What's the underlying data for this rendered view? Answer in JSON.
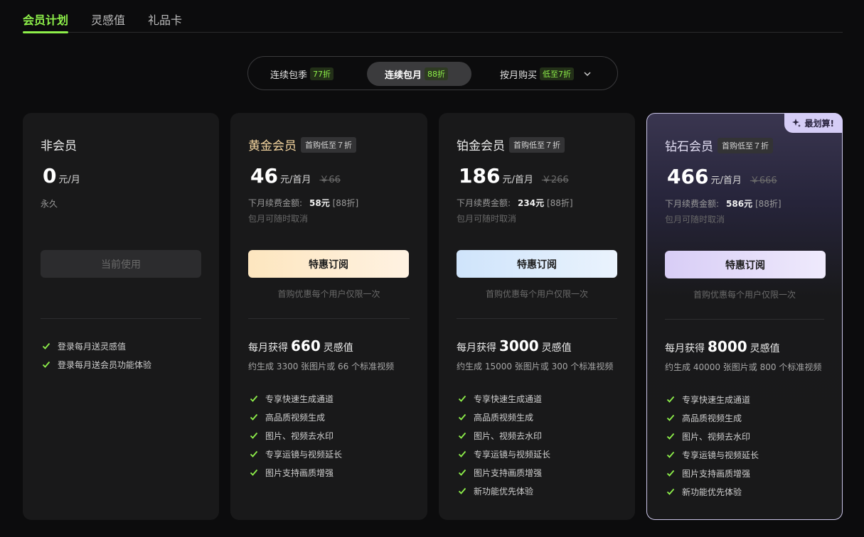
{
  "tabs": [
    {
      "label": "会员计划"
    },
    {
      "label": "灵感值"
    },
    {
      "label": "礼品卡"
    }
  ],
  "billing": {
    "options": [
      {
        "label": "连续包季",
        "badge": "77折"
      },
      {
        "label": "连续包月",
        "badge": "88折"
      },
      {
        "label": "按月购买",
        "badge": "低至7折"
      }
    ],
    "selected": "连续包月"
  },
  "colors": {
    "accent": "#8ef04a",
    "gold": "#fde6bf",
    "platinum": "#cfe4fb",
    "diamond": "#d8cdf6"
  },
  "plans": [
    {
      "name": "非会员",
      "price": "0",
      "unit": "元/月",
      "period_note": "永久",
      "button": "当前使用",
      "features": [
        "登录每月送灵感值",
        "登录每月送会员功能体验"
      ]
    },
    {
      "name": "黄金会员",
      "tag": "首购低至７折",
      "price": "46",
      "unit": "元/首月",
      "orig_price": "￥66",
      "renew_label": "下月续费金额:",
      "renew_amount": "58元",
      "renew_discount": "[88折]",
      "cancel_note": "包月可随时取消",
      "button": "特惠订阅",
      "button_note": "首购优惠每个用户仅限一次",
      "credits_prefix": "每月获得",
      "credits": "660",
      "credits_suffix": "灵感值",
      "gen_note": "约生成 3300 张图片或 66 个标准视频",
      "features": [
        "专享快速生成通道",
        "高品质视频生成",
        "图片、视频去水印",
        "专享运镜与视频延长",
        "图片支持画质增强"
      ]
    },
    {
      "name": "铂金会员",
      "tag": "首购低至７折",
      "price": "186",
      "unit": "元/首月",
      "orig_price": "￥266",
      "renew_label": "下月续费金额:",
      "renew_amount": "234元",
      "renew_discount": "[88折]",
      "cancel_note": "包月可随时取消",
      "button": "特惠订阅",
      "button_note": "首购优惠每个用户仅限一次",
      "credits_prefix": "每月获得",
      "credits": "3000",
      "credits_suffix": "灵感值",
      "gen_note": "约生成 15000 张图片或 300 个标准视频",
      "features": [
        "专享快速生成通道",
        "高品质视频生成",
        "图片、视频去水印",
        "专享运镜与视频延长",
        "图片支持画质增强",
        "新功能优先体验"
      ]
    },
    {
      "name": "钻石会员",
      "tag": "首购低至７折",
      "badge": "最划算!",
      "price": "466",
      "unit": "元/首月",
      "orig_price": "￥666",
      "renew_label": "下月续费金额:",
      "renew_amount": "586元",
      "renew_discount": "[88折]",
      "cancel_note": "包月可随时取消",
      "button": "特惠订阅",
      "button_note": "首购优惠每个用户仅限一次",
      "credits_prefix": "每月获得",
      "credits": "8000",
      "credits_suffix": "灵感值",
      "gen_note": "约生成 40000 张图片或 800 个标准视频",
      "features": [
        "专享快速生成通道",
        "高品质视频生成",
        "图片、视频去水印",
        "专享运镜与视频延长",
        "图片支持画质增强",
        "新功能优先体验"
      ]
    }
  ]
}
